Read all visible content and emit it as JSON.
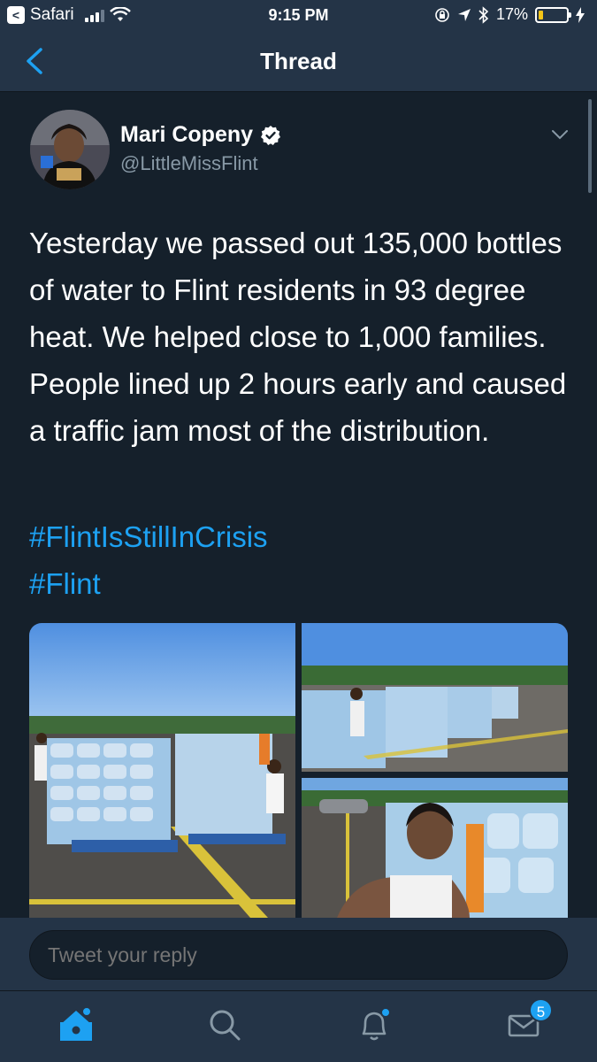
{
  "status_bar": {
    "back_app": "Safari",
    "time": "9:15 PM",
    "battery": "17%",
    "battery_level": 0.17
  },
  "nav": {
    "title": "Thread"
  },
  "tweet": {
    "author_name": "Mari Copeny",
    "author_handle": "@LittleMissFlint",
    "verified": true,
    "text": "Yesterday we passed out 135,000 bottles of water to Flint residents in 93 degree heat. We helped close to 1,000 families. People lined up 2 hours early and caused a traffic jam most of the distribution.",
    "hashtags": [
      "#FlintIsStillInCrisis",
      "#Flint"
    ]
  },
  "reply": {
    "placeholder": "Tweet your reply"
  },
  "tabbar": {
    "messages_badge": "5"
  },
  "colors": {
    "background": "#15202b",
    "bar": "#243447",
    "accent": "#1da1f2",
    "secondary_text": "#8899a6"
  },
  "icons": [
    "back-app-icon",
    "wifi-icon",
    "lock-rotation-icon",
    "location-icon",
    "bluetooth-icon",
    "battery-icon",
    "charging-icon",
    "chevron-left-icon",
    "verified-icon",
    "chevron-down-icon",
    "home-icon",
    "search-icon",
    "bell-icon",
    "mail-icon"
  ]
}
